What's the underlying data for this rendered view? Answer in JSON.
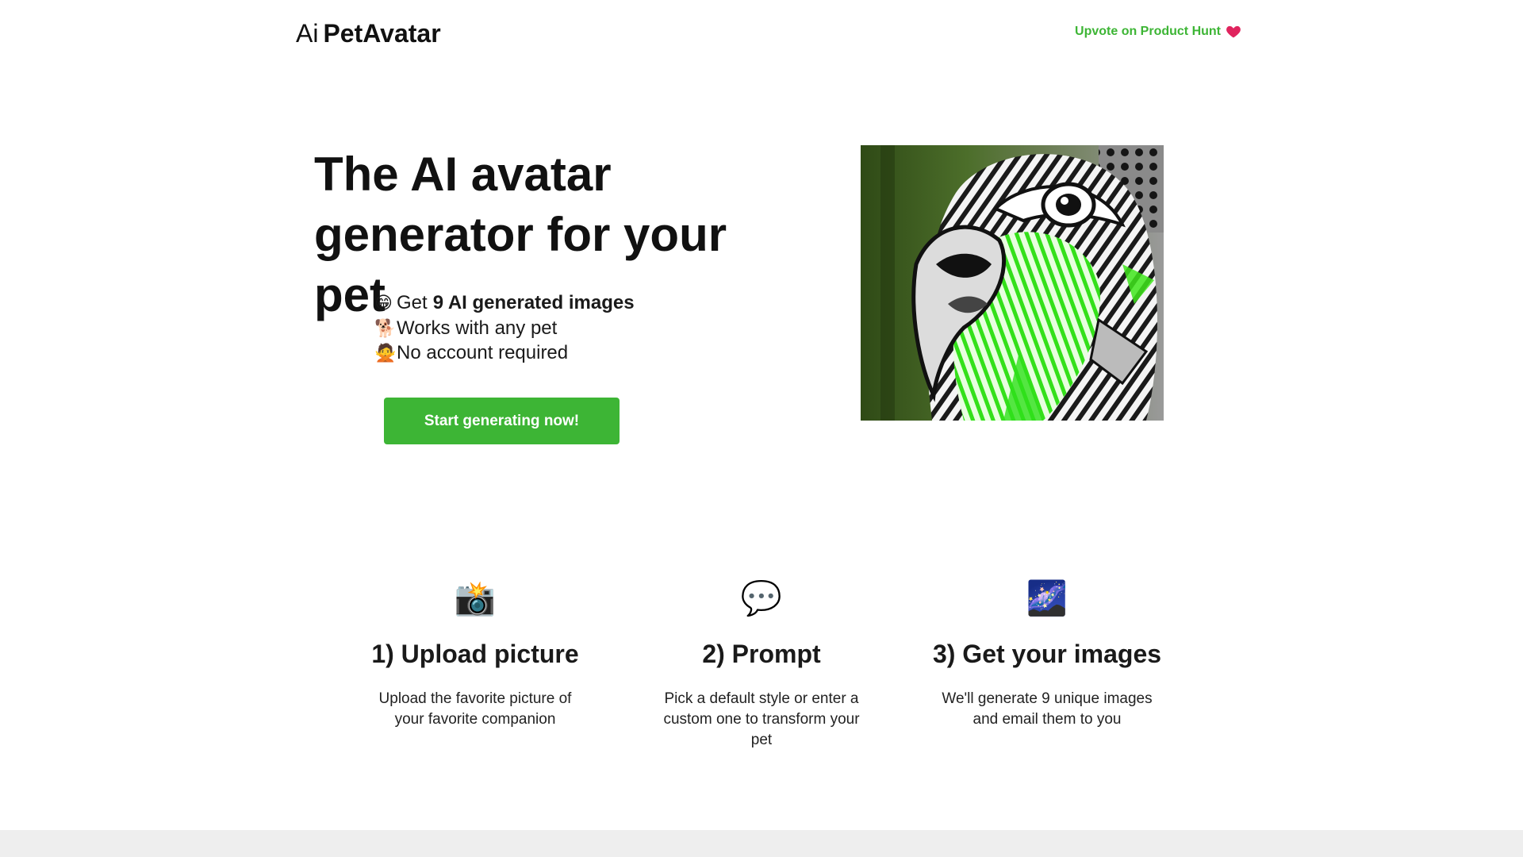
{
  "header": {
    "logo_prefix": "Ai",
    "logo_name": "PetAvatar",
    "upvote_label": "Upvote on Product Hunt"
  },
  "hero": {
    "title": "The AI avatar generator for your pet",
    "features": [
      {
        "emoji": "😁",
        "text": "Get",
        "bold": "9 AI generated images"
      },
      {
        "emoji": "🐕",
        "text": "Works with any pet"
      },
      {
        "emoji": "🙅",
        "text": "No account required"
      }
    ],
    "cta_label": "Start generating now!"
  },
  "steps": [
    {
      "icon": "📸",
      "title": "1) Upload picture",
      "desc": "Upload the favorite picture of your favorite companion"
    },
    {
      "icon": "💬",
      "title": "2) Prompt",
      "desc": "Pick a default style or enter a custom one to transform your pet"
    },
    {
      "icon": "🌌",
      "title": "3) Get your images",
      "desc": "We'll generate 9 unique images and email them to you"
    }
  ],
  "colors": {
    "accent": "#3db535",
    "heart": "#e0245e",
    "footer_band": "#eeeeee"
  }
}
